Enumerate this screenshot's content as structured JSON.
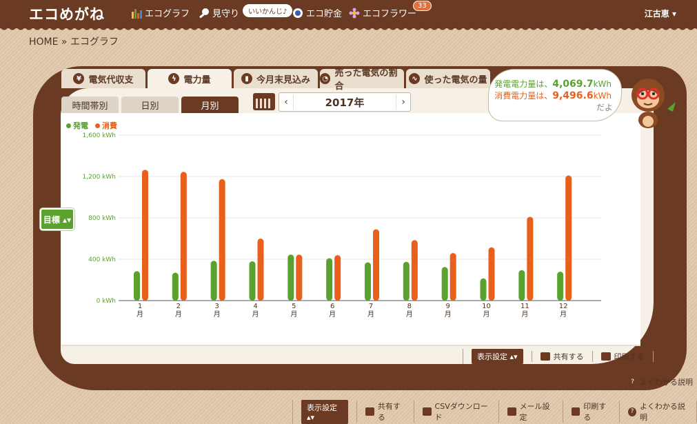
{
  "app": {
    "logo": "エコめがね",
    "user": "江古恵 ▾"
  },
  "nav": {
    "items": [
      {
        "label": "エコグラフ",
        "icon": "bar-graph-icon"
      },
      {
        "label": "見守り",
        "icon": "magnifier-icon"
      },
      {
        "label": "エコ貯金",
        "icon": "coin-icon"
      },
      {
        "label": "エコフラワー",
        "icon": "flower-icon"
      }
    ],
    "bubble": "いいかんじ♪",
    "flower_badge": "33"
  },
  "breadcrumb": "HOME » エコグラフ",
  "tabs": [
    {
      "label": "電気代収支",
      "icon": "yen-icon"
    },
    {
      "label": "電力量",
      "icon": "lightning-icon"
    },
    {
      "label": "今月末見込み",
      "icon": "forecast-bar-icon"
    },
    {
      "label": "売った電気の割合",
      "icon": "pie-icon"
    },
    {
      "label": "使った電気の量",
      "icon": "wave-icon"
    }
  ],
  "subtabs": [
    "時間帯別",
    "日別",
    "月別"
  ],
  "year": {
    "label": "2017年",
    "prev": "‹",
    "next": "›"
  },
  "speech": {
    "gen_prefix": "発電電力量は、",
    "gen_value": "4,069.7",
    "gen_unit": "kWh",
    "use_prefix": "消費電力量は、",
    "use_value": "9,496.6",
    "use_unit": "kWh",
    "suffix": "だよ"
  },
  "goal_button": "目標 ▴▾",
  "chart_data": {
    "type": "bar",
    "categories": [
      "1",
      "2",
      "3",
      "4",
      "5",
      "6",
      "7",
      "8",
      "9",
      "10",
      "11",
      "12"
    ],
    "category_suffix": "月",
    "series": [
      {
        "name": "発電",
        "color": "#5aa12e",
        "values": [
          285,
          270,
          385,
          380,
          445,
          410,
          370,
          375,
          325,
          215,
          295,
          280
        ]
      },
      {
        "name": "消費",
        "color": "#e8601c",
        "values": [
          1265,
          1245,
          1175,
          600,
          445,
          440,
          690,
          585,
          460,
          515,
          810,
          1210
        ]
      }
    ],
    "ylim": [
      0,
      1600
    ],
    "yticks": [
      "0 kWh",
      "400 kWh",
      "800 kWh",
      "1,200 kWh",
      "1,600 kWh"
    ],
    "grid": true,
    "legend": "top-left"
  },
  "toolbar_top": {
    "settings": "表示設定 ▴▾",
    "share": "共有する",
    "print": "印刷する"
  },
  "help1": "よくわかる説明",
  "toolbar_bottom": {
    "settings": "表示設定 ▴▾",
    "share": "共有する",
    "csv": "CSVダウンロード",
    "mail": "メール設定",
    "print": "印刷する",
    "help": "よくわかる説明"
  }
}
